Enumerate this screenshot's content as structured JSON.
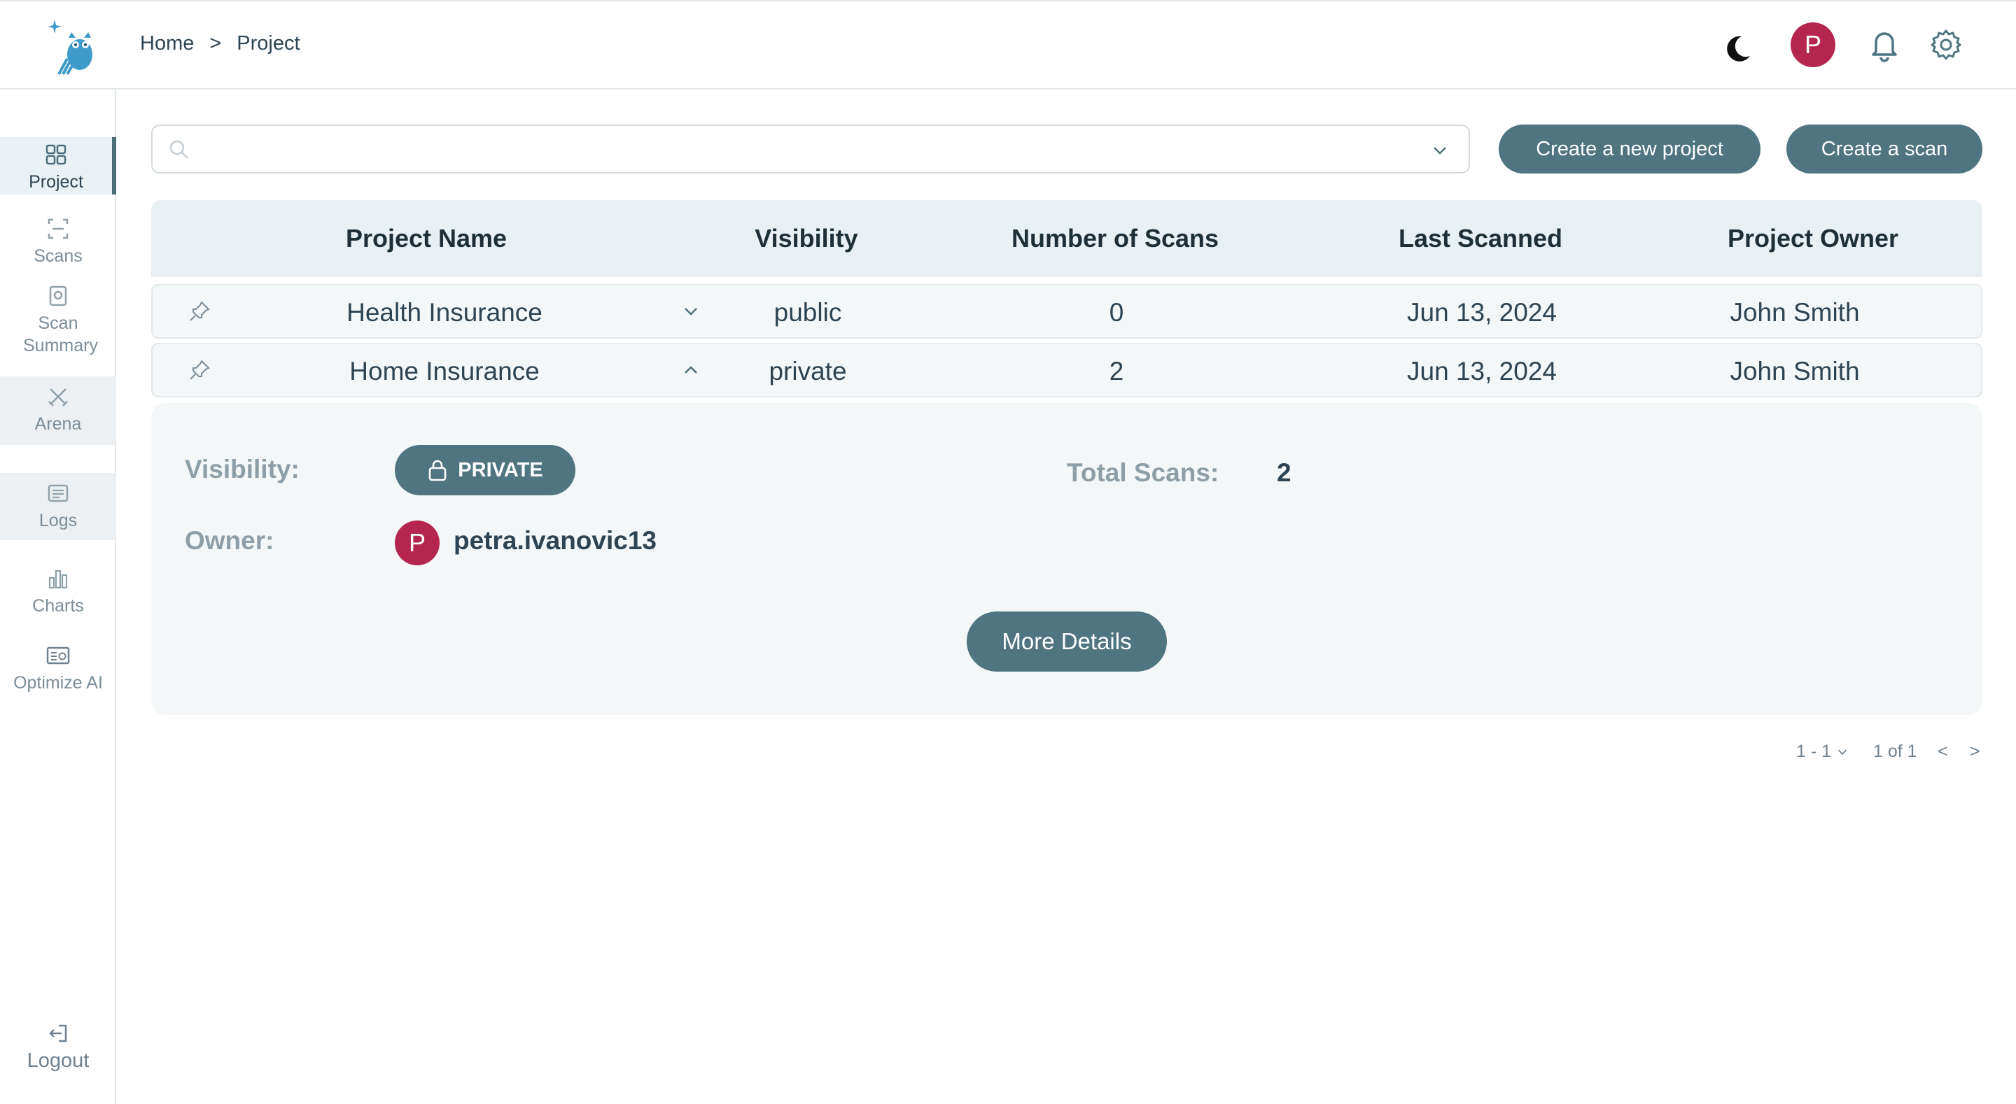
{
  "breadcrumb": {
    "home": "Home",
    "separator": ">",
    "current": "Project"
  },
  "header": {
    "avatar_initial": "P",
    "icons": [
      "moon-icon",
      "bell-icon",
      "gear-icon"
    ]
  },
  "sidebar": {
    "items": [
      {
        "label": "Project",
        "icon": "grid-icon",
        "active": true
      },
      {
        "label": "Scans",
        "icon": "scan-icon"
      },
      {
        "label": "Scan Summary",
        "icon": "scan-summary-icon"
      },
      {
        "label": "Arena",
        "icon": "swords-icon"
      },
      {
        "label": "Logs",
        "icon": "logs-icon"
      },
      {
        "label": "Charts",
        "icon": "bar-chart-icon"
      },
      {
        "label": "Optimize AI",
        "icon": "optimize-icon"
      }
    ],
    "logout": "Logout"
  },
  "search": {
    "value": "",
    "placeholder": ""
  },
  "actions": {
    "create_project": "Create a new project",
    "create_scan": "Create a scan"
  },
  "table": {
    "columns": [
      "Project Name",
      "Visibility",
      "Number of Scans",
      "Last Scanned",
      "Project Owner"
    ],
    "rows": [
      {
        "name": "Health Insurance",
        "visibility": "public",
        "scans": "0",
        "last_scanned": "Jun 13, 2024",
        "owner": "John Smith",
        "expanded": false
      },
      {
        "name": "Home Insurance",
        "visibility": "private",
        "scans": "2",
        "last_scanned": "Jun 13, 2024",
        "owner": "John Smith",
        "expanded": true
      }
    ]
  },
  "details": {
    "visibility_label": "Visibility:",
    "visibility_badge": "PRIVATE",
    "total_scans_label": "Total Scans:",
    "total_scans": "2",
    "owner_label": "Owner:",
    "owner_initial": "P",
    "owner_name": "petra.ivanovic13",
    "more_button": "More Details"
  },
  "pagination": {
    "range": "1 - 1",
    "page_info": "1 of 1",
    "prev": "<",
    "next": ">"
  },
  "colors": {
    "accent": "#4e7580",
    "avatar": "#b4264f",
    "header_bg": "#e8f0f3",
    "row_bg": "#f4f7f8"
  }
}
